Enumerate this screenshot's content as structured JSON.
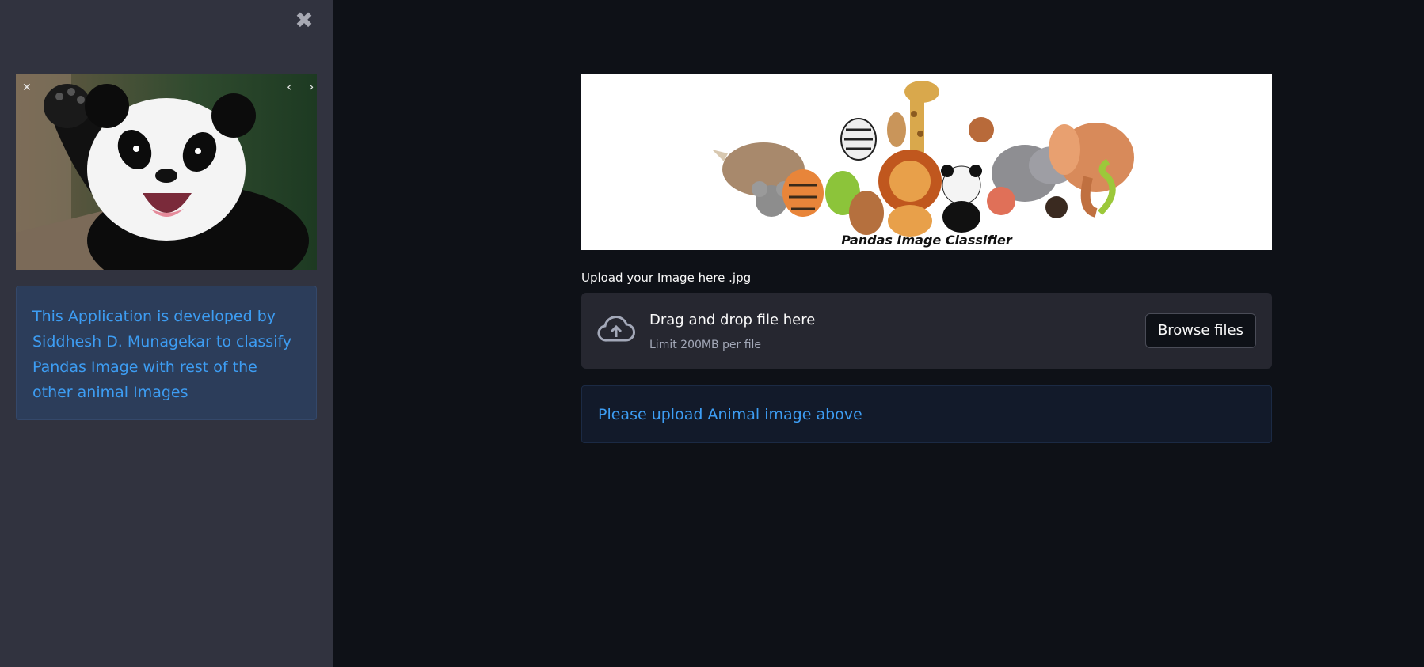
{
  "sidebar": {
    "close_icon": "close-icon",
    "image": {
      "subject": "waving giant panda",
      "controls": {
        "close": "✕",
        "prev": "‹",
        "next": "›"
      }
    },
    "info_text": "This Application is developed by Siddhesh D. Munagekar to classify Pandas Image with rest of the other animal Images"
  },
  "main": {
    "banner": {
      "title": "Pandas Image Classifier"
    },
    "uploader": {
      "label": "Upload your Image here .jpg",
      "dropzone_title": "Drag and drop file here",
      "dropzone_limit": "Limit 200MB per file",
      "browse_label": "Browse files",
      "icon": "cloud-upload-icon"
    },
    "alert": {
      "message": "Please upload Animal image above"
    }
  },
  "colors": {
    "app_bg": "#0e1117",
    "sidebar_bg": "#31333f",
    "info_blue": "#3d9df3",
    "info_bg": "#2c3d5a",
    "dropzone_bg": "#262730"
  }
}
